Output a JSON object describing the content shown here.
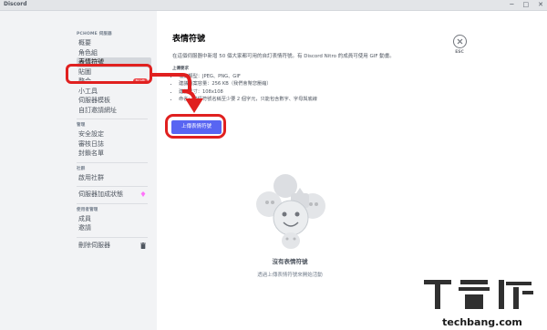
{
  "window": {
    "app_name": "Discord",
    "controls": [
      "─",
      "□",
      "✕"
    ]
  },
  "sidebar": {
    "server_header": "PCHOME 伺服器",
    "server_items": [
      {
        "label": "概要"
      },
      {
        "label": "角色組"
      },
      {
        "label": "表情符號",
        "selected": true
      },
      {
        "label": "貼圖"
      },
      {
        "label": "整合",
        "badge": "新功能"
      },
      {
        "label": "小工具"
      },
      {
        "label": "伺服器模板"
      },
      {
        "label": "自訂邀請網址"
      }
    ],
    "admin_header": "管理",
    "admin_items": [
      {
        "label": "安全設定"
      },
      {
        "label": "審核日誌"
      },
      {
        "label": "封鎖名單"
      }
    ],
    "community_header": "社群",
    "community_items": [
      {
        "label": "啟用社群"
      }
    ],
    "boost_item": {
      "label": "伺服器加成狀態"
    },
    "user_mgmt_header": "使用者管理",
    "user_mgmt_items": [
      {
        "label": "成員"
      },
      {
        "label": "邀請"
      }
    ],
    "delete_item": {
      "label": "刪除伺服器"
    }
  },
  "main": {
    "title": "表情符號",
    "description": "在這個伺服器中新增 50 個大家都可用的自訂表情符號。有 Discord Nitro 的成員可使用 GIF 動畫。",
    "requirements_title": "上傳要求",
    "requirements": [
      "檔案類型：JPEG、PNG、GIF",
      "建議檔案容量：256 KB（我們會幫您壓縮）",
      "建議尺寸：108x108",
      "命名：表情符號名稱至少要 2 個字元，只能包含數字、字母與底線"
    ],
    "upload_button": "上傳表情符號",
    "esc_label": "ESC",
    "empty_title": "沒有表情符號",
    "empty_subtitle": "透過上傳表情符號來開始活動"
  },
  "watermark": {
    "text": "T客邦",
    "site": "techbang.com"
  },
  "colors": {
    "accent": "#5865f2",
    "highlight": "#e0201f",
    "sidebar_bg": "#f2f3f5",
    "danger": "#ed4245"
  }
}
